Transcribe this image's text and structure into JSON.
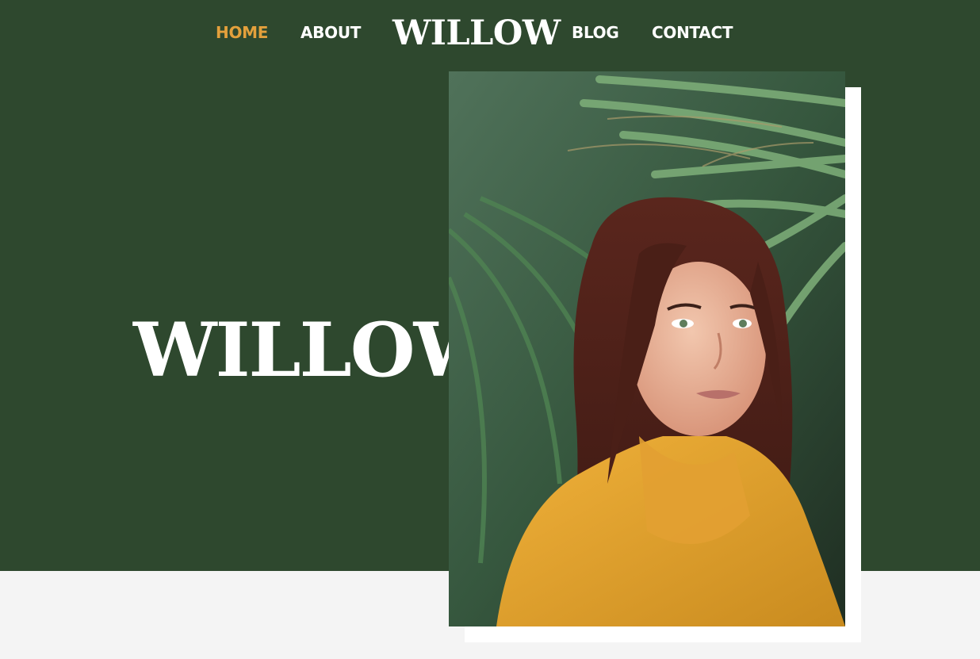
{
  "nav": {
    "home": "HOME",
    "about": "ABOUT",
    "logo": "WILLOW",
    "blog": "BLOG",
    "contact": "CONTACT"
  },
  "hero": {
    "title": "WILLOW",
    "photo_icon": "portrait-photo"
  },
  "colors": {
    "hero_background": "#2e482e",
    "accent": "#e3a03c",
    "text": "#ffffff",
    "page_background": "#f4f4f4"
  }
}
